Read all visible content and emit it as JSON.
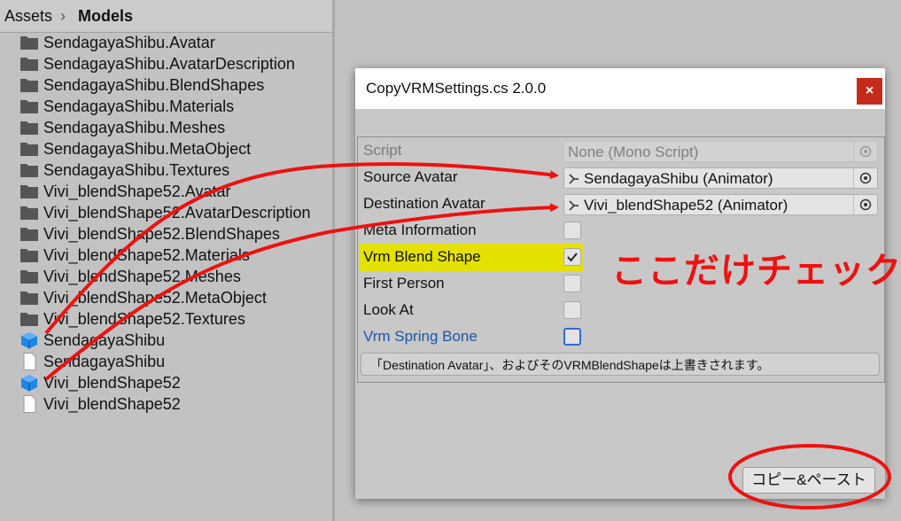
{
  "project": {
    "breadcrumb": {
      "root": "Assets",
      "separator": "›",
      "current": "Models"
    },
    "assets": [
      {
        "label": "SendagayaShibu.Avatar",
        "icon": "folder"
      },
      {
        "label": "SendagayaShibu.AvatarDescription",
        "icon": "folder"
      },
      {
        "label": "SendagayaShibu.BlendShapes",
        "icon": "folder"
      },
      {
        "label": "SendagayaShibu.Materials",
        "icon": "folder"
      },
      {
        "label": "SendagayaShibu.Meshes",
        "icon": "folder"
      },
      {
        "label": "SendagayaShibu.MetaObject",
        "icon": "folder"
      },
      {
        "label": "SendagayaShibu.Textures",
        "icon": "folder"
      },
      {
        "label": "Vivi_blendShape52.Avatar",
        "icon": "folder"
      },
      {
        "label": "Vivi_blendShape52.AvatarDescription",
        "icon": "folder"
      },
      {
        "label": "Vivi_blendShape52.BlendShapes",
        "icon": "folder"
      },
      {
        "label": "Vivi_blendShape52.Materials",
        "icon": "folder"
      },
      {
        "label": "Vivi_blendShape52.Meshes",
        "icon": "folder"
      },
      {
        "label": "Vivi_blendShape52.MetaObject",
        "icon": "folder"
      },
      {
        "label": "Vivi_blendShape52.Textures",
        "icon": "folder"
      },
      {
        "label": "SendagayaShibu",
        "icon": "prefab-cube"
      },
      {
        "label": "SendagayaShibu",
        "icon": "file"
      },
      {
        "label": "Vivi_blendShape52",
        "icon": "prefab-cube"
      },
      {
        "label": "Vivi_blendShape52",
        "icon": "file"
      }
    ]
  },
  "window": {
    "title": "CopyVRMSettings.cs 2.0.0",
    "close_label": "×",
    "fields": {
      "script": {
        "label": "Script",
        "value": "None (Mono Script)"
      },
      "source_avatar": {
        "label": "Source Avatar",
        "value": "SendagayaShibu (Animator)"
      },
      "destination_avatar": {
        "label": "Destination Avatar",
        "value": "Vivi_blendShape52 (Animator)"
      },
      "meta_information": {
        "label": "Meta Information",
        "checked": false
      },
      "vrm_blend_shape": {
        "label": "Vrm Blend Shape",
        "checked": true
      },
      "first_person": {
        "label": "First Person",
        "checked": false
      },
      "look_at": {
        "label": "Look At",
        "checked": false
      },
      "vrm_spring_bone": {
        "label": "Vrm Spring Bone",
        "checked": false
      }
    },
    "help_text": "「Destination Avatar」、およびそのVRMBlendShapeは上書きされます。",
    "copy_paste_button": "コピー&ペースト"
  },
  "annotation": {
    "callout_text": "ここだけチェック",
    "color": "#ee1111",
    "highlight_color": "#e4e100"
  }
}
